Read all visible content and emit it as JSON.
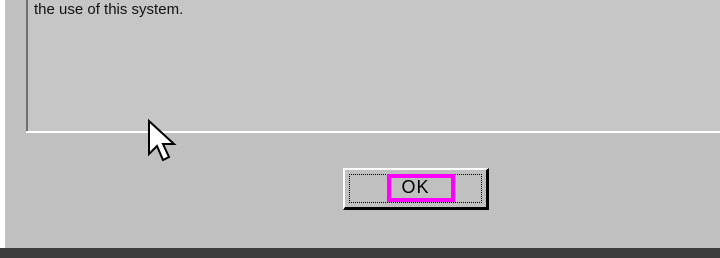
{
  "dialog": {
    "message": "the use of this system.",
    "ok_label": "OK",
    "highlight_color": "#ff00ff",
    "background_color": "#c0c0c0"
  },
  "cursor": {
    "icon": "arrow-pointer-icon"
  }
}
